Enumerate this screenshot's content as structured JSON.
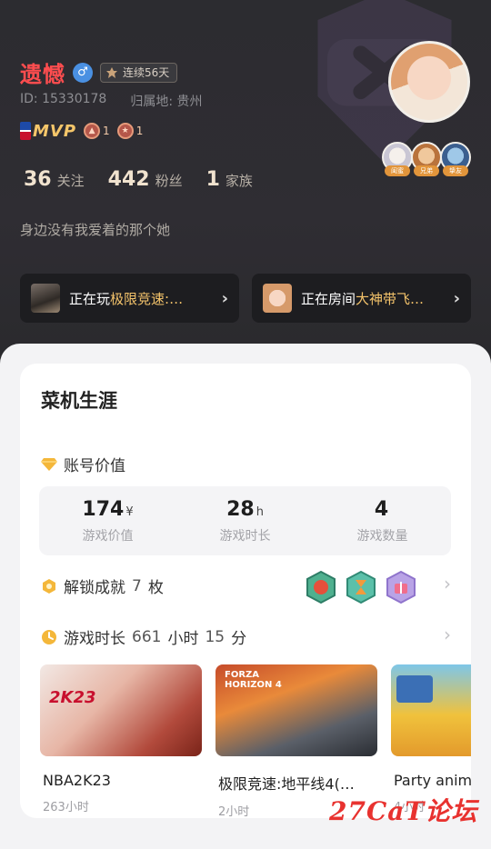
{
  "profile": {
    "username": "遗憾",
    "gender_icon": "male-icon",
    "streak_label": "连续56天",
    "id_text": "ID: 15330178",
    "location_text": "归属地: 贵州",
    "mvp_label": "MVP",
    "medal1_count": "1",
    "medal2_count": "1",
    "stats": [
      {
        "num": "36",
        "label": "关注"
      },
      {
        "num": "442",
        "label": "粉丝"
      },
      {
        "num": "1",
        "label": "家族"
      }
    ],
    "bio": "身边没有我爱着的那个她",
    "mini_tags": [
      "闺蜜",
      "兄弟",
      "挚友"
    ]
  },
  "now_playing": {
    "game_prefix": "正在玩",
    "game_title": "极限竞速:…",
    "room_prefix": "正在房间",
    "room_title": "大神带飞…"
  },
  "career": {
    "title": "菜机生涯",
    "account_value_label": "账号价值",
    "values": [
      {
        "num": "174",
        "unit": "¥",
        "label": "游戏价值"
      },
      {
        "num": "28",
        "unit": "h",
        "label": "游戏时长"
      },
      {
        "num": "4",
        "unit": "",
        "label": "游戏数量"
      }
    ],
    "achievement_prefix": "解锁成就",
    "achievement_count": "7",
    "achievement_suffix": "枚",
    "playtime_prefix": "游戏时长",
    "playtime_hours": "661",
    "playtime_hours_unit": "小时",
    "playtime_minutes": "15",
    "playtime_minutes_unit": "分",
    "games": [
      {
        "name": "NBA2K23",
        "hours": "263小时",
        "art_text": "2K23"
      },
      {
        "name": "极限竞速:地平线4(…",
        "hours": "2小时",
        "art_text": "FORZA HORIZON 4"
      },
      {
        "name": "Party anim",
        "hours": "4小时",
        "art_text": ""
      }
    ]
  },
  "watermark": "27CaT论坛",
  "colors": {
    "accent_red": "#ff4d4f",
    "gold": "#f5c46b",
    "panel_bg": "#f3f3f5"
  }
}
